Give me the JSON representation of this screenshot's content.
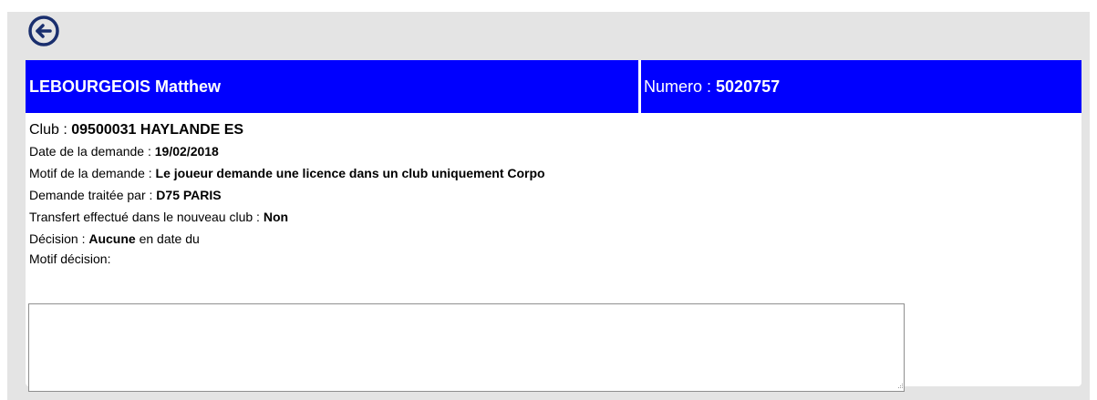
{
  "nav": {
    "back_icon": "arrow-left-circle-icon"
  },
  "header": {
    "player_name": "LEBOURGEOIS Matthew",
    "numero_label": "Numero : ",
    "numero_value": "5020757"
  },
  "details": {
    "club_label": "Club : ",
    "club_value": "09500031 HAYLANDE ES",
    "date_label": "Date de la demande : ",
    "date_value": "19/02/2018",
    "motif_label": "Motif de la demande : ",
    "motif_value": "Le joueur demande une licence dans un club uniquement Corpo",
    "traitee_label": "Demande traitée par : ",
    "traitee_value": "D75 PARIS",
    "transfert_label": "Transfert effectué dans le nouveau club : ",
    "transfert_value": "Non",
    "decision_label": "Décision : ",
    "decision_value": "Aucune",
    "decision_suffix": " en date du",
    "motif_decision_label": "Motif décision:"
  },
  "motif_decision": {
    "value": ""
  },
  "colors": {
    "header_bg": "#0000ff",
    "page_bg": "#e4e4e4"
  }
}
